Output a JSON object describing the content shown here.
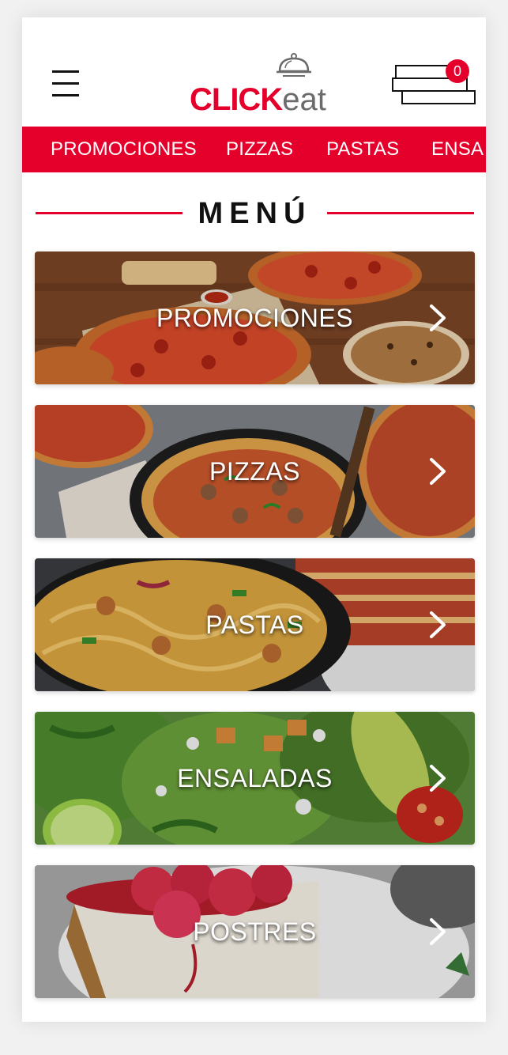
{
  "app": {
    "logo_text_red": "CLICK",
    "logo_text_gray": "eat",
    "cart_count": "0"
  },
  "nav": {
    "items": [
      {
        "label": "PROMOCIONES"
      },
      {
        "label": "PIZZAS"
      },
      {
        "label": "PASTAS"
      },
      {
        "label": "ENSA"
      }
    ]
  },
  "menu": {
    "title": "MENÚ",
    "cards": [
      {
        "label": "PROMOCIONES"
      },
      {
        "label": "PIZZAS"
      },
      {
        "label": "PASTAS"
      },
      {
        "label": "ENSALADAS"
      },
      {
        "label": "POSTRES"
      }
    ]
  },
  "icons": {
    "menu": "hamburger-menu-icon",
    "cart": "cart-icon",
    "chevron": "chevron-right-icon",
    "logo": "cloche-dome-icon"
  },
  "colors": {
    "brand_red": "#e4002b",
    "logo_gray": "#6b6b6b",
    "text_dark": "#111111"
  }
}
